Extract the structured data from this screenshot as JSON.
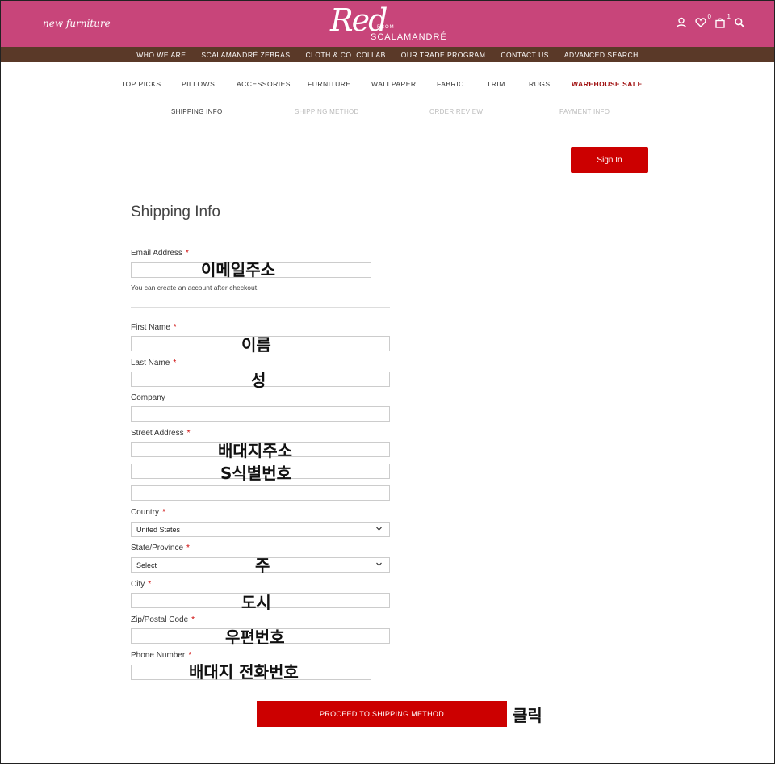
{
  "header": {
    "tagline": "new furniture",
    "logo": {
      "word": "Red",
      "from": "FROM",
      "brand": "SCALAMANDRÉ"
    },
    "wishlist_count": "0",
    "cart_count": "1",
    "bg_color": "#c8457a"
  },
  "nav_top": [
    "WHO WE ARE",
    "SCALAMANDRÉ ZEBRAS",
    "CLOTH & CO. COLLAB",
    "OUR TRADE PROGRAM",
    "CONTACT US",
    "ADVANCED SEARCH"
  ],
  "nav_main": [
    "TOP PICKS",
    "PILLOWS",
    "ACCESSORIES",
    "FURNITURE",
    "WALLPAPER",
    "FABRIC",
    "TRIM",
    "RUGS",
    "WAREHOUSE SALE"
  ],
  "steps": [
    "SHIPPING INFO",
    "SHIPPING METHOD",
    "ORDER REVIEW",
    "PAYMENT INFO"
  ],
  "sign_in": "Sign In",
  "form": {
    "title": "Shipping Info",
    "email_label": "Email Address",
    "email_note": "You can create an account after checkout.",
    "first_name_label": "First Name",
    "last_name_label": "Last Name",
    "company_label": "Company",
    "street_label": "Street Address",
    "country_label": "Country",
    "country_value": "United States",
    "state_label": "State/Province",
    "state_value": "Select",
    "city_label": "City",
    "zip_label": "Zip/Postal Code",
    "phone_label": "Phone Number",
    "required_mark": "*",
    "proceed_label": "PROCEED TO SHIPPING METHOD"
  },
  "annotations": {
    "email": "이메일주소",
    "first_name": "이름",
    "last_name": "성",
    "street1": "배대지주소",
    "street2": "S식별번호",
    "state": "주",
    "city": "도시",
    "zip": "우편번호",
    "phone": "배대지 전화번호",
    "click": "클릭"
  },
  "colors": {
    "accent": "#cc0000",
    "nav_bar": "#5a3928"
  }
}
